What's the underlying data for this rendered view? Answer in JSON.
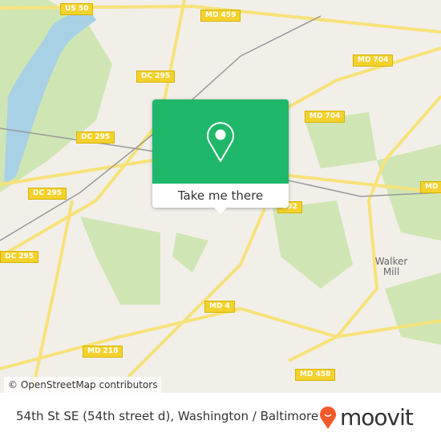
{
  "map": {
    "route_shields": [
      "US 50",
      "MD 459",
      "MD 704",
      "DC 295",
      "MD 704",
      "DC 295",
      "DC 295",
      "DC 295",
      "332",
      "MD",
      "MD 4",
      "MD 218",
      "MD 458"
    ],
    "places": [
      "Walker Mill"
    ],
    "attribution": "© OpenStreetMap contributors",
    "colors": {
      "land": "#f2efe9",
      "park": "#cfe6b4",
      "water": "#a9d1e6",
      "road": "#f7e27a",
      "popup": "#1fb86a"
    }
  },
  "popup": {
    "icon": "map-pin-icon",
    "button_label": "Take me there"
  },
  "footer": {
    "address": "54th St SE (54th street d), Washington / Baltimore",
    "brand": "moovit",
    "brand_color": "#f25a2a"
  }
}
